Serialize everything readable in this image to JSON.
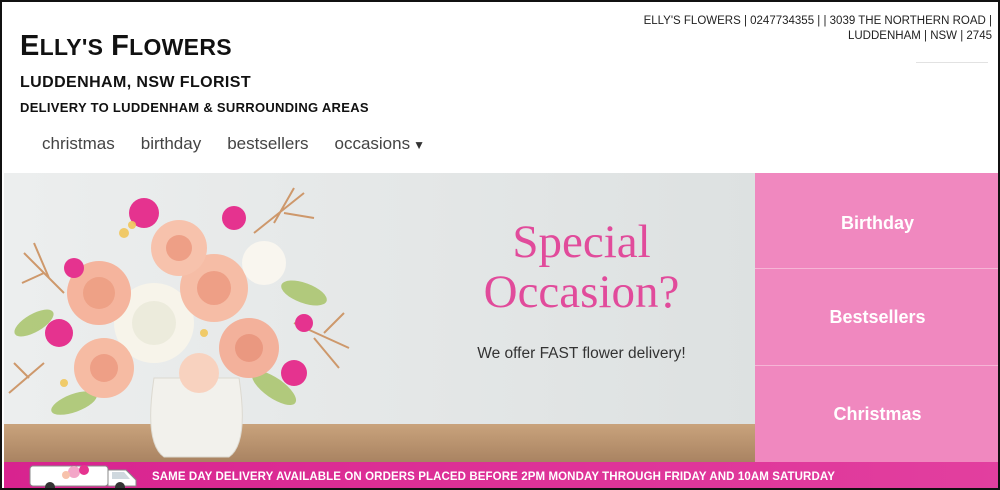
{
  "header": {
    "title_first": "E",
    "title_rest": "LLY'S",
    "title_second_first": "F",
    "title_second_rest": "LOWERS",
    "tagline": "LUDDENHAM, NSW FLORIST",
    "delivery_line": "DELIVERY TO LUDDENHAM & SURROUNDING AREAS",
    "contact_line1": "ELLY'S FLOWERS | 0247734355 | | 3039 THE NORTHERN ROAD |",
    "contact_line2": "LUDDENHAM | NSW | 2745"
  },
  "nav": {
    "items": [
      {
        "label": "christmas"
      },
      {
        "label": "birthday"
      },
      {
        "label": "bestsellers"
      },
      {
        "label": "occasions"
      }
    ],
    "dropdown_icon": "caret-down-icon"
  },
  "hero": {
    "title_line1": "Special",
    "title_line2": "Occasion?",
    "subtitle": "We offer FAST flower delivery!",
    "accent_color": "#e14b9b"
  },
  "side_links": [
    {
      "label": "Birthday"
    },
    {
      "label": "Bestsellers"
    },
    {
      "label": "Christmas"
    }
  ],
  "banner": {
    "text": "SAME DAY DELIVERY AVAILABLE ON ORDERS PLACED BEFORE 2PM MONDAY THROUGH FRIDAY AND 10AM SATURDAY",
    "icon": "delivery-van-icon",
    "color": "#d8238f"
  },
  "colors": {
    "side_panel": "#f088bf",
    "banner": "#d8238f"
  }
}
